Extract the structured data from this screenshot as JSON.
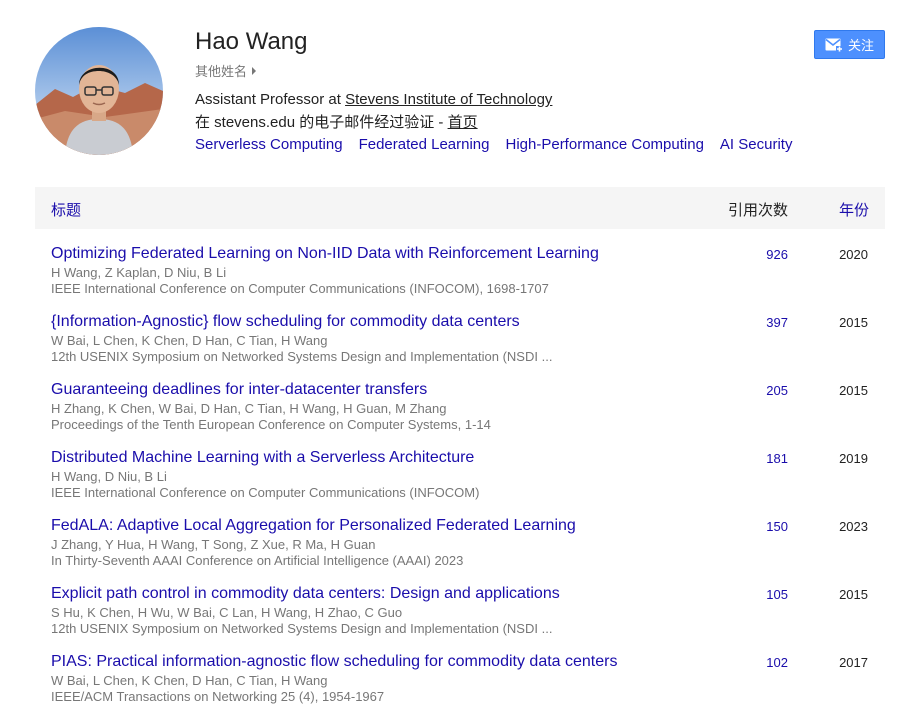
{
  "profile": {
    "name": "Hao Wang",
    "other_names_label": "其他姓名",
    "affiliation_prefix": "Assistant Professor at ",
    "affiliation_link": "Stevens Institute of Technology",
    "email_prefix": "在 stevens.edu 的电子邮件经过验证 - ",
    "homepage_label": "首页",
    "interests": [
      "Serverless Computing",
      "Federated Learning",
      "High-Performance Computing",
      "AI Security"
    ]
  },
  "follow_button": {
    "label": "关注",
    "icon": "mail-icon",
    "color": "#4d90fe"
  },
  "table": {
    "col_title": "标题",
    "col_cited": "引用次数",
    "col_year": "年份",
    "rows": [
      {
        "title": "Optimizing Federated Learning on Non-IID Data with Reinforcement Learning",
        "authors": "H Wang, Z Kaplan, D Niu, B Li",
        "venue": "IEEE International Conference on Computer Communications (INFOCOM), 1698-1707",
        "cites": "926",
        "year": "2020"
      },
      {
        "title": "{Information-Agnostic} flow scheduling for commodity data centers",
        "authors": "W Bai, L Chen, K Chen, D Han, C Tian, H Wang",
        "venue": "12th USENIX Symposium on Networked Systems Design and Implementation (NSDI ...",
        "cites": "397",
        "year": "2015"
      },
      {
        "title": "Guaranteeing deadlines for inter-datacenter transfers",
        "authors": "H Zhang, K Chen, W Bai, D Han, C Tian, H Wang, H Guan, M Zhang",
        "venue": "Proceedings of the Tenth European Conference on Computer Systems, 1-14",
        "cites": "205",
        "year": "2015"
      },
      {
        "title": "Distributed Machine Learning with a Serverless Architecture",
        "authors": "H Wang, D Niu, B Li",
        "venue": "IEEE International Conference on Computer Communications (INFOCOM)",
        "cites": "181",
        "year": "2019"
      },
      {
        "title": "FedALA: Adaptive Local Aggregation for Personalized Federated Learning",
        "authors": "J Zhang, Y Hua, H Wang, T Song, Z Xue, R Ma, H Guan",
        "venue": "In Thirty-Seventh AAAI Conference on Artificial Intelligence (AAAI) 2023",
        "cites": "150",
        "year": "2023"
      },
      {
        "title": "Explicit path control in commodity data centers: Design and applications",
        "authors": "S Hu, K Chen, H Wu, W Bai, C Lan, H Wang, H Zhao, C Guo",
        "venue": "12th USENIX Symposium on Networked Systems Design and Implementation (NSDI ...",
        "cites": "105",
        "year": "2015"
      },
      {
        "title": "PIAS: Practical information-agnostic flow scheduling for commodity data centers",
        "authors": "W Bai, L Chen, K Chen, D Han, C Tian, H Wang",
        "venue": "IEEE/ACM Transactions on Networking 25 (4), 1954-1967",
        "cites": "102",
        "year": "2017"
      }
    ]
  }
}
